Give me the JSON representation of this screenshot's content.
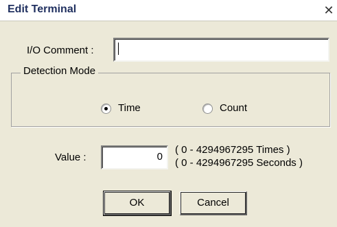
{
  "window": {
    "title": "Edit Terminal",
    "close_glyph": "✕"
  },
  "io_comment": {
    "label": "I/O Comment :",
    "value": ""
  },
  "detection_mode": {
    "legend": "Detection Mode",
    "options": [
      {
        "label": "Time",
        "selected": true
      },
      {
        "label": "Count",
        "selected": false
      }
    ]
  },
  "value_field": {
    "label": "Value :",
    "value": "0",
    "range_times": "( 0 - 4294967295 Times )",
    "range_seconds": "( 0 - 4294967295 Seconds )"
  },
  "buttons": {
    "ok": "OK",
    "cancel": "Cancel"
  }
}
